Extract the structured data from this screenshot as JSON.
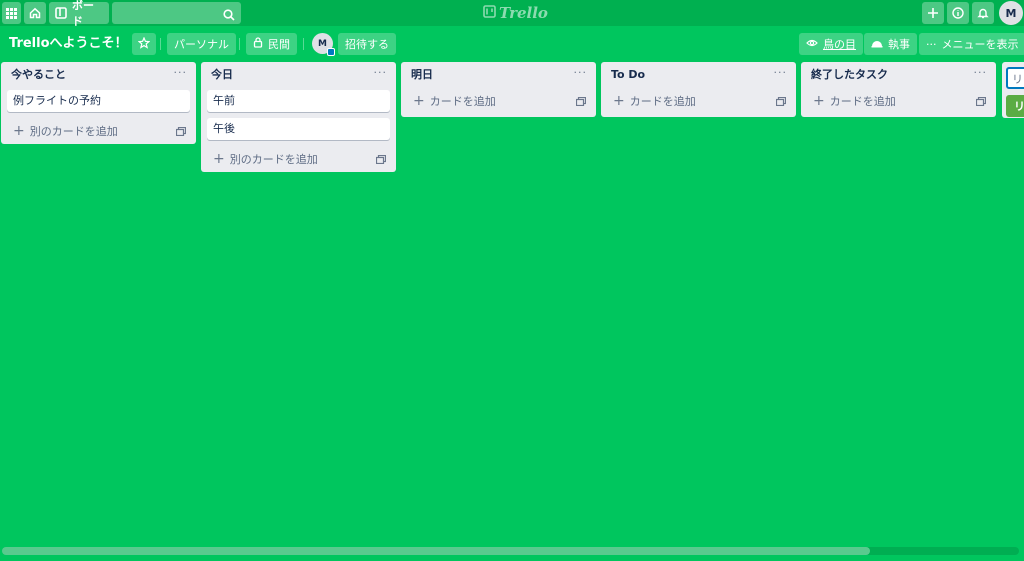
{
  "header": {
    "boards_label": "ボード",
    "logo_text": "Trello",
    "avatar_initial": "M",
    "icons": [
      "apps-icon",
      "home-icon",
      "board-icon",
      "search-icon",
      "plus-icon",
      "info-icon",
      "bell-icon"
    ]
  },
  "board": {
    "title": "Trelloへようこそ！",
    "team_label": "パーソナル",
    "visibility_label": "民間",
    "member_initial": "M",
    "invite_label": "招待する",
    "butler_label": "鳥の目",
    "butler2_label": "執事",
    "menu_label": "メニューを表示"
  },
  "lists": [
    {
      "title": "今やること",
      "cards": [
        "例フライトの予約"
      ],
      "add_label": "別のカードを追加"
    },
    {
      "title": "今日",
      "cards": [
        "午前",
        "午後"
      ],
      "add_label": "別のカードを追加"
    },
    {
      "title": "明日",
      "cards": [],
      "add_label": "カードを追加"
    },
    {
      "title": "To Do",
      "cards": [],
      "add_label": "カードを追加"
    },
    {
      "title": "終了したタスク",
      "cards": [],
      "add_label": "カードを追加"
    }
  ],
  "add_list": {
    "placeholder": "リ",
    "button_label": "リ"
  },
  "colors": {
    "board_bg": "#00c65e",
    "header_bg": "#00b050",
    "list_bg": "#ebecf0",
    "add_button": "#5aac44",
    "input_border": "#0079bf"
  },
  "scroll_fraction": 0.85
}
